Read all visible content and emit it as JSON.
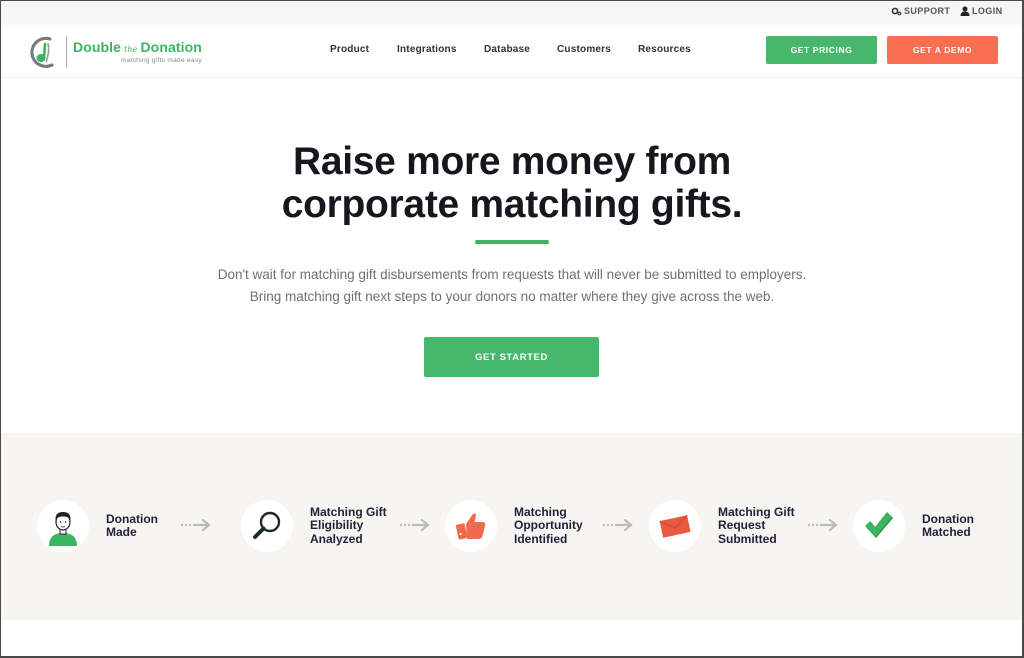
{
  "topbar": {
    "support_label": "SUPPORT",
    "login_label": "LOGIN"
  },
  "brand": {
    "name_part1": "Double",
    "name_the": "the",
    "name_part2": "Donation",
    "tagline": "matching gifts made easy",
    "green": "#3cb563",
    "coral": "#fa6e52"
  },
  "nav": {
    "items": [
      {
        "label": "Product"
      },
      {
        "label": "Integrations"
      },
      {
        "label": "Database"
      },
      {
        "label": "Customers"
      },
      {
        "label": "Resources"
      }
    ],
    "pricing_label": "GET PRICING",
    "demo_label": "GET A DEMO"
  },
  "hero": {
    "title_line1": "Raise more money from",
    "title_line2": "corporate matching gifts.",
    "sub_line1": "Don't wait for matching gift disbursements from requests that will never be submitted to employers.",
    "sub_line2": "Bring matching gift next steps to your donors no matter where they give across the web.",
    "cta_label": "GET STARTED"
  },
  "process": {
    "steps": [
      {
        "icon": "donor-avatar-icon",
        "line1": "Donation",
        "line2": "Made",
        "line3": ""
      },
      {
        "icon": "magnifier-icon",
        "line1": "Matching Gift",
        "line2": "Eligibility",
        "line3": "Analyzed"
      },
      {
        "icon": "thumbs-up-icon",
        "line1": "Matching",
        "line2": "Opportunity",
        "line3": "Identified"
      },
      {
        "icon": "envelope-icon",
        "line1": "Matching Gift",
        "line2": "Request",
        "line3": "Submitted"
      },
      {
        "icon": "checkmark-icon",
        "line1": "Donation",
        "line2": "Matched",
        "line3": ""
      }
    ]
  }
}
